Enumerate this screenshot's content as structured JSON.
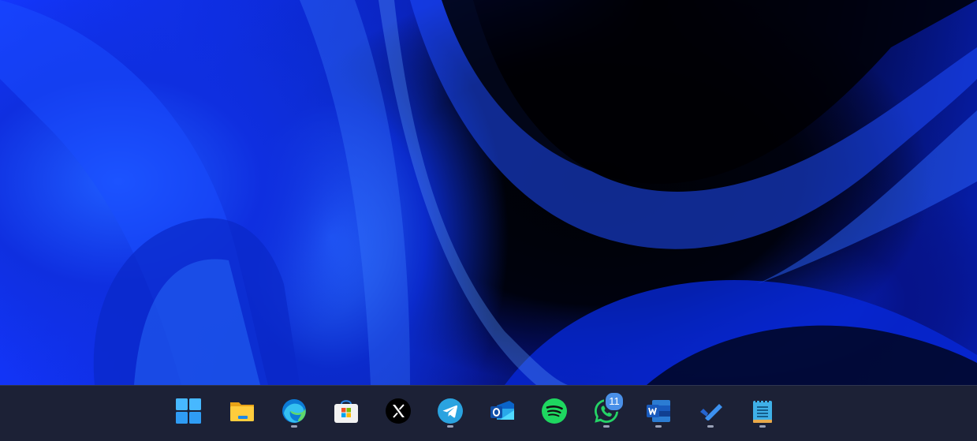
{
  "taskbar": {
    "badges": {
      "whatsapp": "11"
    }
  },
  "colors": {
    "taskbar_background": "#1c2136",
    "wallpaper_accent": "#1437ff",
    "badge": "#4a90e8"
  }
}
